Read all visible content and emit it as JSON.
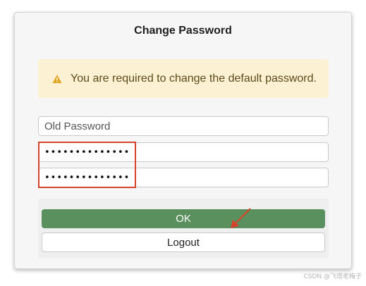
{
  "dialog": {
    "title": "Change Password"
  },
  "alert": {
    "icon": "warning-icon",
    "icon_color": "#e0a520",
    "background": "#fcf1d3",
    "text": "You are required to change the default password."
  },
  "form": {
    "old_password": {
      "placeholder": "Old Password",
      "value": ""
    },
    "new_password": {
      "value": "••••••••••••••"
    },
    "confirm_password": {
      "value": "••••••••••••••"
    }
  },
  "buttons": {
    "ok_label": "OK",
    "ok_color": "#5a8f5e",
    "logout_label": "Logout"
  },
  "annotation": {
    "highlight_color": "#d8432c",
    "arrow_color": "#d8432c"
  },
  "watermark": "CSDN @飞塔老梅子"
}
